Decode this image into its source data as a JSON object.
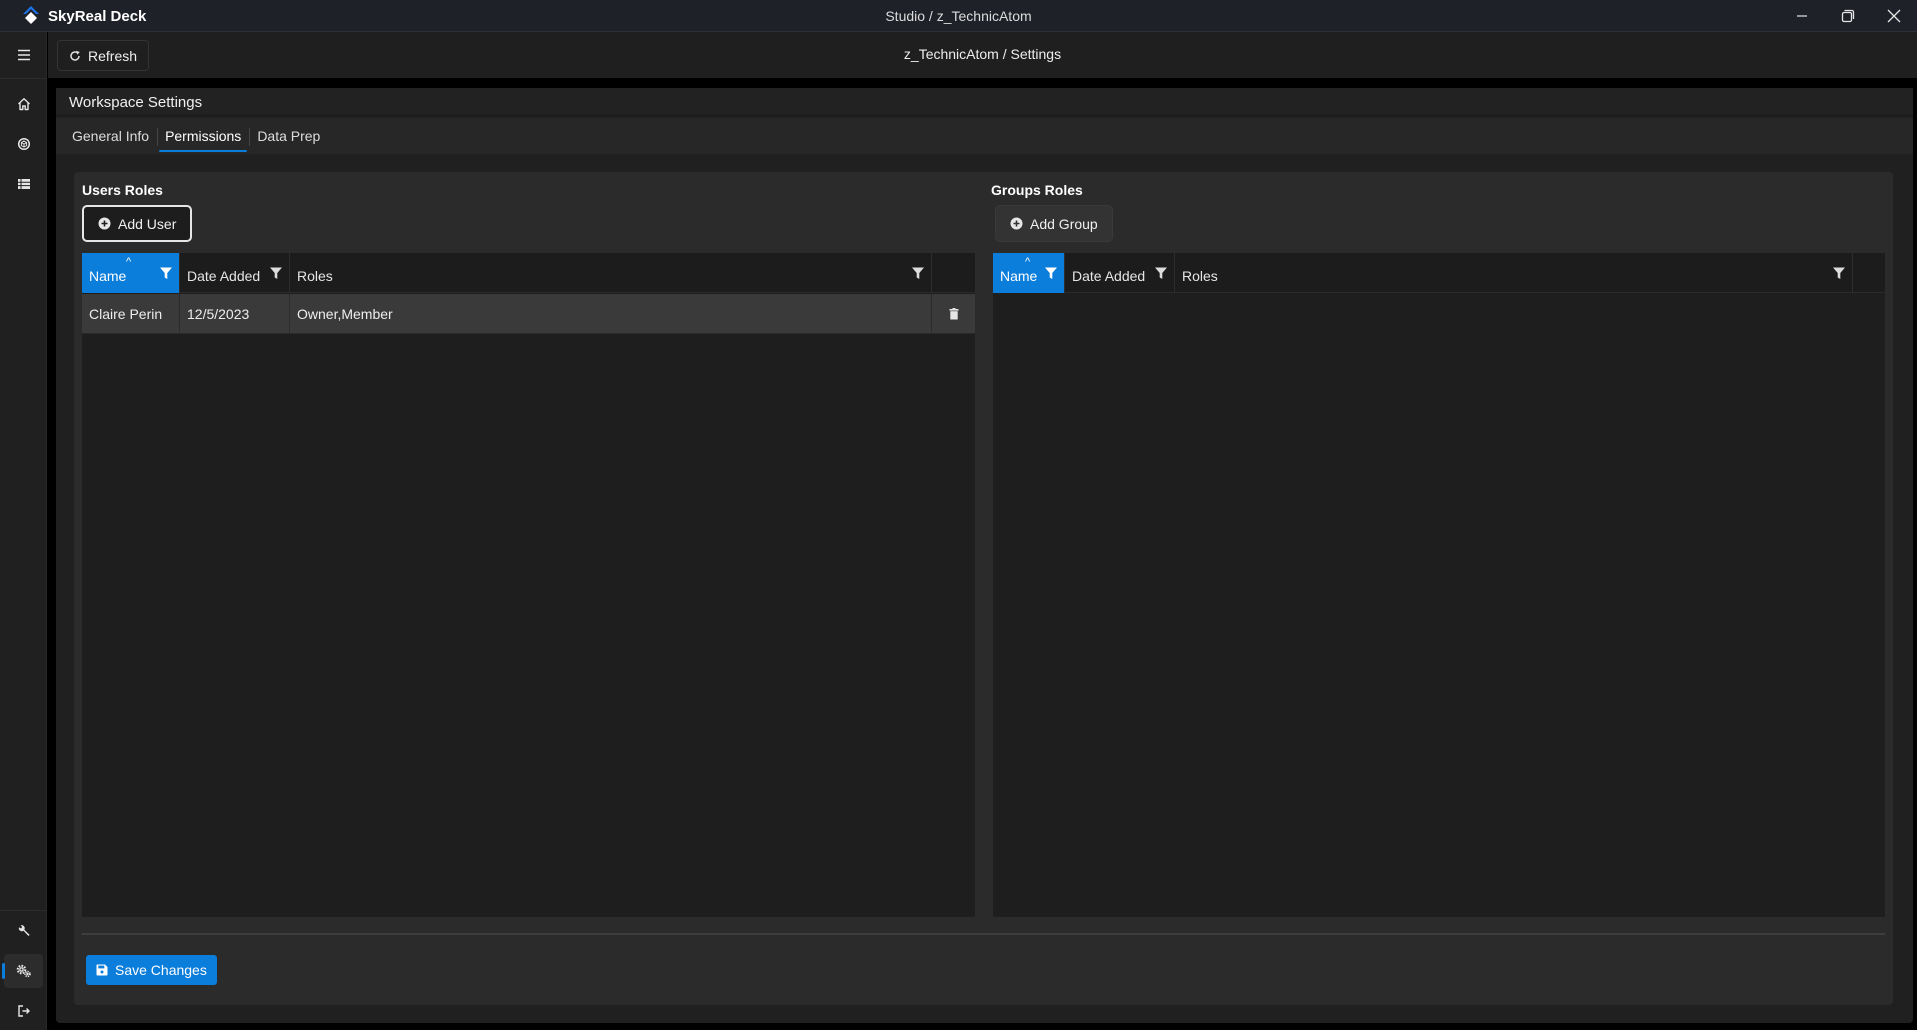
{
  "app": {
    "name": "SkyReal Deck",
    "window_title": "Studio / z_TechnicAtom",
    "accent_color": "#0b7ddb",
    "window_controls": [
      "minimize",
      "restore",
      "close"
    ]
  },
  "sidebar": {
    "top_items": [
      {
        "icon": "menu-icon",
        "label": "Menu"
      },
      {
        "icon": "home-icon",
        "label": "Home"
      },
      {
        "icon": "cube-icon",
        "label": "Studio"
      },
      {
        "icon": "list-icon",
        "label": "List"
      }
    ],
    "bottom_items": [
      {
        "icon": "wrench-icon",
        "label": "Tools"
      },
      {
        "icon": "gears-icon",
        "label": "Settings",
        "active": true
      },
      {
        "icon": "logout-icon",
        "label": "Logout"
      }
    ]
  },
  "toolbar": {
    "refresh_label": "Refresh",
    "breadcrumb": "z_TechnicAtom / Settings"
  },
  "workspace": {
    "title": "Workspace Settings",
    "tabs": [
      {
        "label": "General Info",
        "active": false
      },
      {
        "label": "Permissions",
        "active": true
      },
      {
        "label": "Data Prep",
        "active": false
      }
    ],
    "users": {
      "title": "Users Roles",
      "add_label": "Add User",
      "columns": [
        "Name",
        "Date Added",
        "Roles"
      ],
      "sorted_column": "Name",
      "rows": [
        {
          "name": "Claire Perin",
          "date_added": "12/5/2023",
          "roles": "Owner,Member"
        }
      ]
    },
    "groups": {
      "title": "Groups Roles",
      "add_label": "Add Group",
      "columns": [
        "Name",
        "Date Added",
        "Roles"
      ],
      "sorted_column": "Name",
      "rows": []
    },
    "save_label": "Save Changes"
  }
}
